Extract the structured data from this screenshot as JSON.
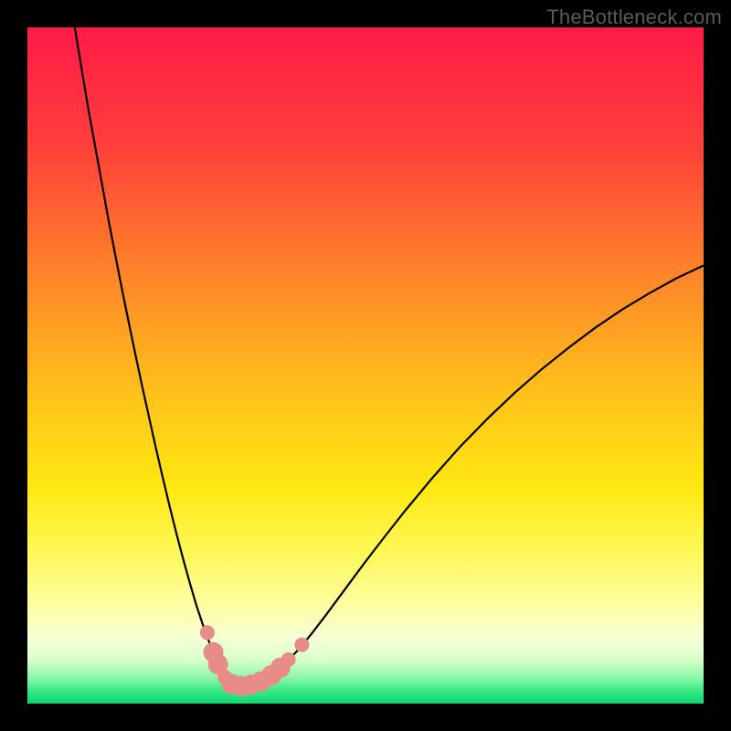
{
  "watermark": "TheBottleneck.com",
  "chart_data": {
    "type": "line",
    "title": "",
    "xlabel": "",
    "ylabel": "",
    "xlim": [
      0,
      100
    ],
    "ylim": [
      0,
      100
    ],
    "axes_visible": false,
    "grid": false,
    "legend": false,
    "background_gradient": {
      "stops": [
        {
          "offset": 0.0,
          "color": "#ff1a48"
        },
        {
          "offset": 0.18,
          "color": "#ff413a"
        },
        {
          "offset": 0.38,
          "color": "#ff8a28"
        },
        {
          "offset": 0.55,
          "color": "#ffc41a"
        },
        {
          "offset": 0.68,
          "color": "#ffe812"
        },
        {
          "offset": 0.78,
          "color": "#fff85a"
        },
        {
          "offset": 0.86,
          "color": "#fdffa8"
        },
        {
          "offset": 0.905,
          "color": "#f6ffd8"
        },
        {
          "offset": 0.935,
          "color": "#d8ffc8"
        },
        {
          "offset": 0.962,
          "color": "#8cf7a8"
        },
        {
          "offset": 0.982,
          "color": "#35e884"
        },
        {
          "offset": 1.0,
          "color": "#10d66f"
        }
      ]
    },
    "series": [
      {
        "name": "bottleneck-curve",
        "color": "#000000",
        "x": [
          7,
          8,
          9,
          10,
          11,
          12,
          13,
          14,
          15,
          16,
          17,
          18,
          19,
          20,
          21,
          22,
          23,
          24,
          25,
          26,
          27,
          28,
          28.5,
          29,
          29.5,
          30,
          30.5,
          31,
          32,
          33,
          34,
          35,
          36,
          37,
          38,
          40,
          42,
          44,
          46,
          48,
          50,
          53,
          56,
          60,
          64,
          68,
          72,
          76,
          80,
          84,
          88,
          92,
          96,
          100
        ],
        "y": [
          100,
          94,
          88,
          82.5,
          77,
          71.5,
          66.3,
          61.2,
          56.3,
          51.5,
          46.8,
          42.3,
          37.8,
          33.5,
          29.3,
          25.3,
          21.5,
          17.9,
          14.5,
          11.5,
          8.8,
          6.5,
          5.5,
          4.6,
          3.9,
          3.3,
          2.9,
          2.7,
          2.6,
          2.7,
          3.0,
          3.5,
          4.1,
          4.9,
          5.8,
          7.9,
          10.3,
          12.9,
          15.6,
          18.3,
          21.0,
          24.9,
          28.7,
          33.5,
          38.0,
          42.1,
          45.9,
          49.4,
          52.6,
          55.6,
          58.3,
          60.7,
          62.9,
          64.8
        ]
      }
    ],
    "markers": {
      "name": "highlight-points",
      "color": "#e98b86",
      "radius_small": 8,
      "radius_large": 11,
      "points": [
        {
          "x": 26.6,
          "y": 10.5,
          "r": "small"
        },
        {
          "x": 27.5,
          "y": 7.6,
          "r": "large"
        },
        {
          "x": 28.2,
          "y": 5.8,
          "r": "large"
        },
        {
          "x": 29.2,
          "y": 3.9,
          "r": "small"
        },
        {
          "x": 30.2,
          "y": 2.9,
          "r": "large"
        },
        {
          "x": 31.6,
          "y": 2.6,
          "r": "large"
        },
        {
          "x": 33.1,
          "y": 2.8,
          "r": "large"
        },
        {
          "x": 34.6,
          "y": 3.3,
          "r": "large"
        },
        {
          "x": 36.1,
          "y": 4.2,
          "r": "large"
        },
        {
          "x": 37.4,
          "y": 5.3,
          "r": "large"
        },
        {
          "x": 38.6,
          "y": 6.5,
          "r": "small"
        },
        {
          "x": 40.6,
          "y": 8.7,
          "r": "small"
        }
      ]
    }
  }
}
